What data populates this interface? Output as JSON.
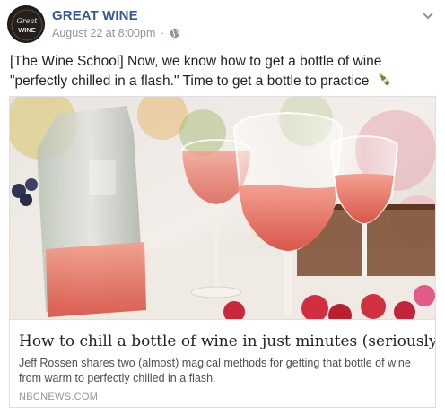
{
  "post": {
    "page_name": "GREAT WINE",
    "timestamp": "August 22 at 8:00pm",
    "separator": "·",
    "privacy_icon": "globe-icon",
    "avatar": {
      "line1": "Great",
      "line2": "WINE",
      "icon": "wine-logo"
    },
    "text": "[The Wine School] Now, we know how to get a bottle of wine \"perfectly chilled in a flash.\" Time to get a bottle to practice",
    "text_emoji": "champagne-bottle-icon",
    "menu_icon": "chevron-down-icon"
  },
  "link": {
    "image": "rose-wine-glasses-photo",
    "title": "How to chill a bottle of wine in just minutes (seriously)",
    "description": "Jeff Rossen shares two (almost) magical methods for getting that bottle of wine from warm to perfectly chilled in a flash.",
    "domain": "NBCNEWS.COM"
  },
  "colors": {
    "link_blue": "#365899",
    "meta_grey": "#90949c",
    "text": "#1d2129",
    "rose": "#e8806f"
  }
}
